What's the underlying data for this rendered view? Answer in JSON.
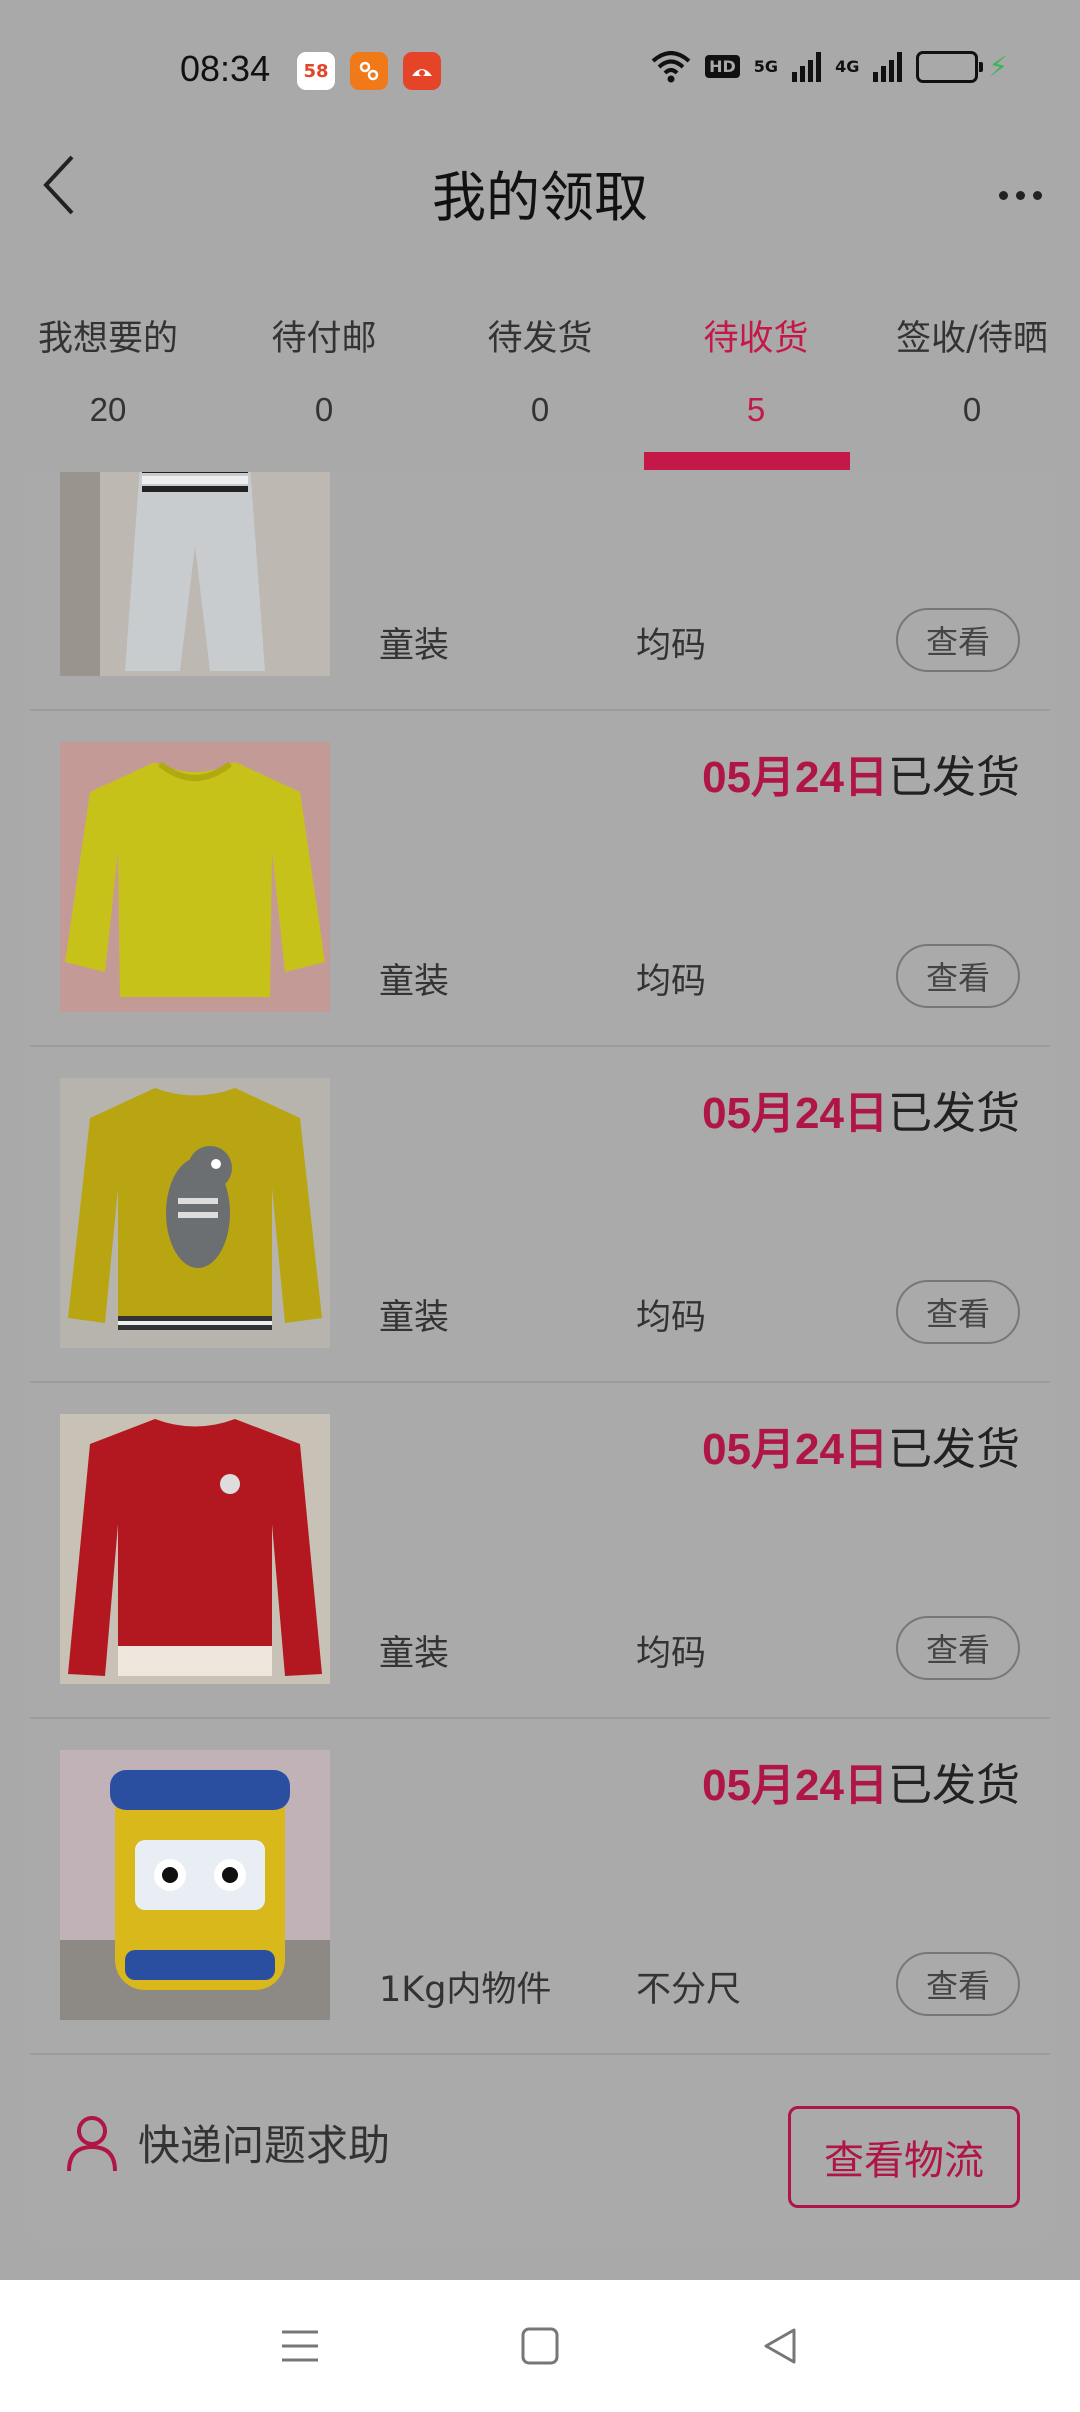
{
  "status_bar": {
    "time": "08:34",
    "apps": [
      "58",
      "app-orange",
      "app-red"
    ],
    "hd": "HD",
    "net1": "5G",
    "net2": "4G"
  },
  "header": {
    "title": "我的领取"
  },
  "tabs": [
    {
      "label": "我想要的",
      "count": "20"
    },
    {
      "label": "待付邮",
      "count": "0"
    },
    {
      "label": "待发货",
      "count": "0"
    },
    {
      "label": "待收货",
      "count": "5",
      "active": true
    },
    {
      "label": "签收/待晒",
      "count": "0"
    }
  ],
  "items": [
    {
      "date": "",
      "state": "",
      "category": "童装",
      "size": "均码",
      "view": "查看",
      "image": "grey-kids-pants"
    },
    {
      "date": "05月24日",
      "state": "已发货",
      "category": "童装",
      "size": "均码",
      "view": "查看",
      "image": "yellow-knit-sweater"
    },
    {
      "date": "05月24日",
      "state": "已发货",
      "category": "童装",
      "size": "均码",
      "view": "查看",
      "image": "yellow-dinosaur-sweater"
    },
    {
      "date": "05月24日",
      "state": "已发货",
      "category": "童装",
      "size": "均码",
      "view": "查看",
      "image": "red-sweater"
    },
    {
      "date": "05月24日",
      "state": "已发货",
      "category": "1Kg内物件",
      "size": "不分尺",
      "view": "查看",
      "image": "toy-bus"
    }
  ],
  "footer": {
    "help": "快递问题求助",
    "logistics": "查看物流"
  },
  "colors": {
    "accent": "#c41848",
    "overlay": "#a9a9a9",
    "battery": "#3ab35a"
  }
}
